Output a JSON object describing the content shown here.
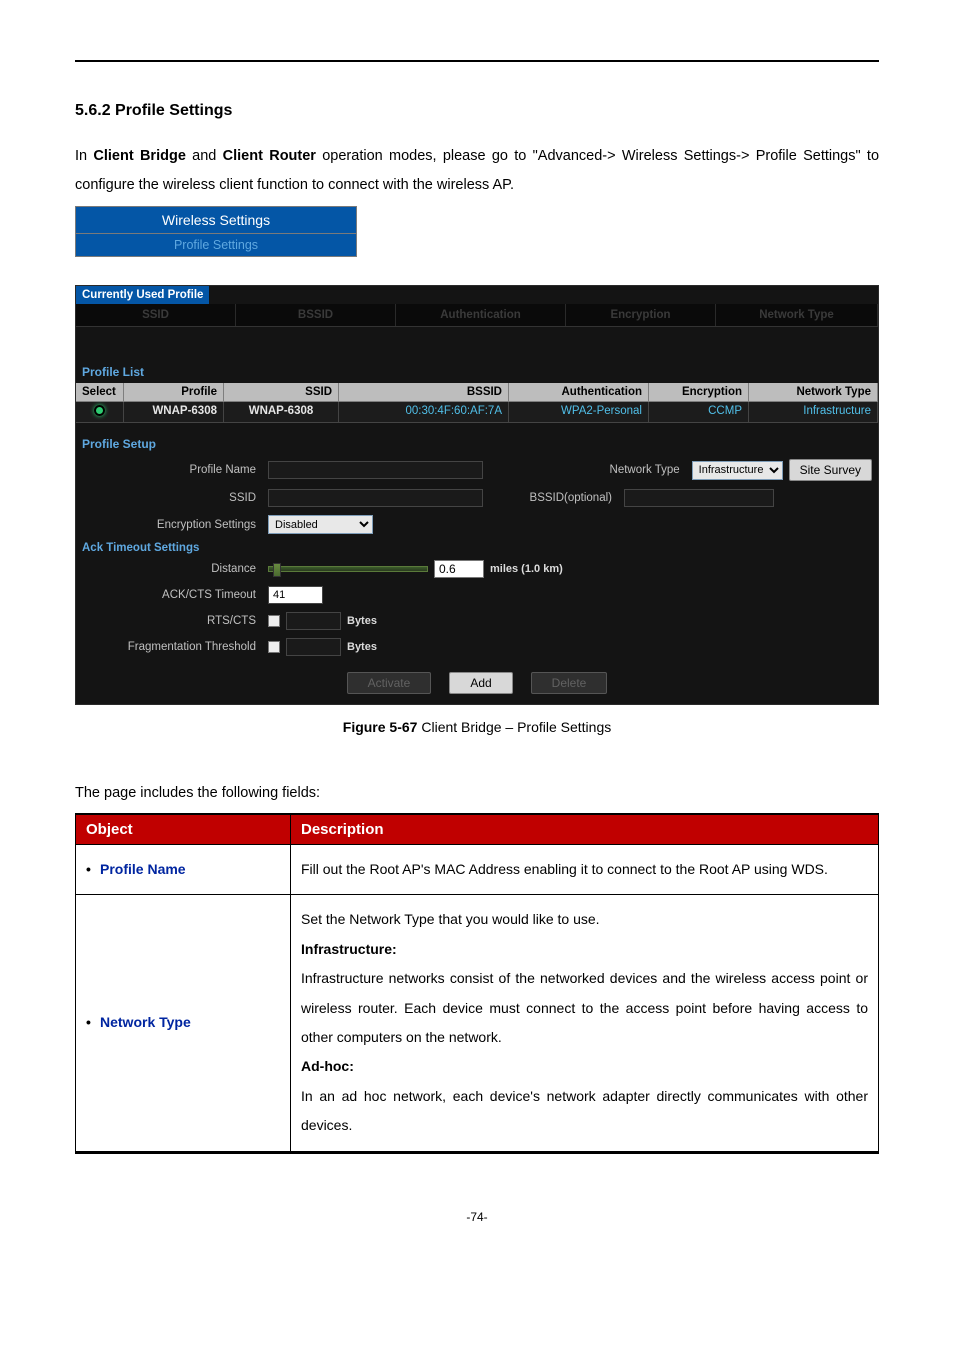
{
  "heading": "5.6.2  Profile Settings",
  "intro": {
    "prefix": "In ",
    "b1": "Client Bridge",
    "mid": " and ",
    "b2": "Client Router",
    "suffix": " operation modes, please go to \"Advanced-> Wireless Settings-> Profile Settings\" to configure the wireless client function to connect with the wireless AP."
  },
  "tabs": {
    "main": "Wireless Settings",
    "sub": "Profile Settings"
  },
  "currently_used": {
    "title": "Currently Used Profile",
    "headers": [
      "SSID",
      "BSSID",
      "Authentication",
      "Encryption",
      "Network Type"
    ]
  },
  "profile_list": {
    "title": "Profile List",
    "headers": {
      "select": "Select",
      "profile": "Profile",
      "ssid": "SSID",
      "bssid": "BSSID",
      "auth": "Authentication",
      "enc": "Encryption",
      "net": "Network Type"
    },
    "row": {
      "profile": "WNAP-6308",
      "ssid": "WNAP-6308",
      "bssid": "00:30:4F:60:AF:7A",
      "auth": "WPA2-Personal",
      "enc": "CCMP",
      "net": "Infrastructure"
    }
  },
  "profile_setup": {
    "title": "Profile Setup",
    "labels": {
      "profile_name": "Profile Name",
      "network_type": "Network Type",
      "site_survey": "Site Survey",
      "ssid": "SSID",
      "bssid_optional": "BSSID(optional)",
      "encryption_settings": "Encryption Settings"
    },
    "network_type_value": "Infrastructure",
    "encryption_value": "Disabled"
  },
  "ack": {
    "title": "Ack Timeout Settings",
    "labels": {
      "distance": "Distance",
      "miles_value": "0.6",
      "miles_unit": "miles (1.0 km)",
      "ackcts": "ACK/CTS Timeout",
      "ackcts_value": "41",
      "rtscts": "RTS/CTS",
      "bytes": "Bytes",
      "frag": "Fragmentation Threshold"
    }
  },
  "buttons": {
    "activate": "Activate",
    "add": "Add",
    "delete": "Delete"
  },
  "figure": {
    "label": "Figure 5-67",
    "text": " Client Bridge – Profile Settings"
  },
  "fields_intro": "The page includes the following fields:",
  "def_table": {
    "headers": {
      "object": "Object",
      "description": "Description"
    },
    "rows": [
      {
        "object": "Profile Name",
        "description_html": "Fill out the Root AP's MAC Address enabling it to connect to the Root AP using WDS."
      },
      {
        "object": "Network Type",
        "description": {
          "p1": "Set the Network Type that you would like to use.",
          "h1": "Infrastructure",
          "p2": "Infrastructure networks consist of the networked devices and the wireless access point or wireless router. Each device must connect to the access point before having access to other computers on the network.",
          "h2": "Ad-hoc",
          "p3": "In an ad hoc network, each device's network adapter directly communicates with other devices."
        }
      }
    ]
  },
  "page_number": "-74-"
}
